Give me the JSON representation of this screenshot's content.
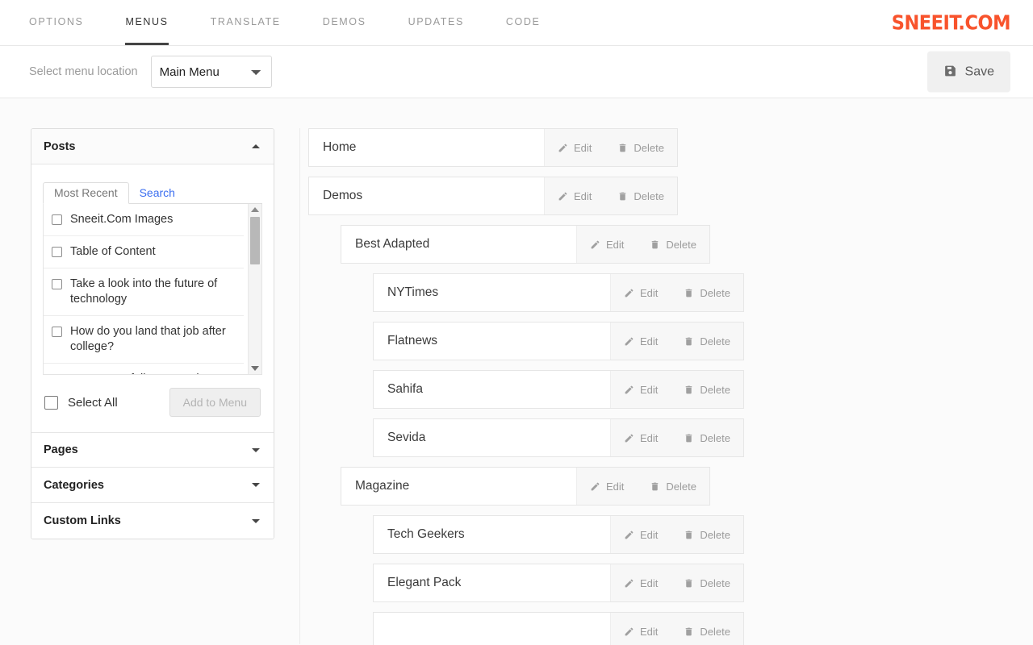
{
  "nav": {
    "tabs": [
      {
        "label": "OPTIONS",
        "active": false
      },
      {
        "label": "MENUS",
        "active": true
      },
      {
        "label": "TRANSLATE",
        "active": false
      },
      {
        "label": "DEMOS",
        "active": false
      },
      {
        "label": "UPDATES",
        "active": false
      },
      {
        "label": "CODE",
        "active": false
      }
    ],
    "brand": "SNEEIT.COM"
  },
  "toolbar": {
    "select_label": "Select menu location",
    "select_value": "Main Menu",
    "select_options": [
      "Main Menu"
    ],
    "save_label": "Save",
    "save_icon": "save-floppy-icon"
  },
  "sidebar": {
    "panels": [
      {
        "title": "Posts",
        "expanded": true,
        "caret": "caret-up"
      },
      {
        "title": "Pages",
        "expanded": false,
        "caret": "caret-down"
      },
      {
        "title": "Categories",
        "expanded": false,
        "caret": "caret-down"
      },
      {
        "title": "Custom Links",
        "expanded": false,
        "caret": "caret-down"
      }
    ],
    "posts_panel": {
      "tabs": [
        {
          "label": "Most Recent",
          "active": true
        },
        {
          "label": "Search",
          "active": false
        }
      ],
      "items": [
        {
          "label": "Sneeit.Com Images",
          "checked": false
        },
        {
          "label": "Table of Content",
          "checked": false
        },
        {
          "label": "Take a look into the future of technology",
          "checked": false
        },
        {
          "label": "How do you land that job after college?",
          "checked": false
        },
        {
          "label": "Summer to fall street style:",
          "checked": false
        }
      ],
      "select_all_label": "Select All",
      "select_all_checked": false,
      "add_to_menu_label": "Add to Menu"
    }
  },
  "menu_tree": {
    "edit_label": "Edit",
    "delete_label": "Delete",
    "items": [
      {
        "label": "Home",
        "level": 0
      },
      {
        "label": "Demos",
        "level": 0
      },
      {
        "label": "Best Adapted",
        "level": 1
      },
      {
        "label": "NYTimes",
        "level": 2
      },
      {
        "label": "Flatnews",
        "level": 2
      },
      {
        "label": "Sahifa",
        "level": 2
      },
      {
        "label": "Sevida",
        "level": 2
      },
      {
        "label": "Magazine",
        "level": 1
      },
      {
        "label": "Tech Geekers",
        "level": 2
      },
      {
        "label": "Elegant Pack",
        "level": 2
      },
      {
        "label": "",
        "level": 2
      }
    ]
  },
  "colors": {
    "brand": "#f8532c",
    "link": "#3b6ef0",
    "text": "#333333",
    "muted": "#9b9b9b"
  }
}
